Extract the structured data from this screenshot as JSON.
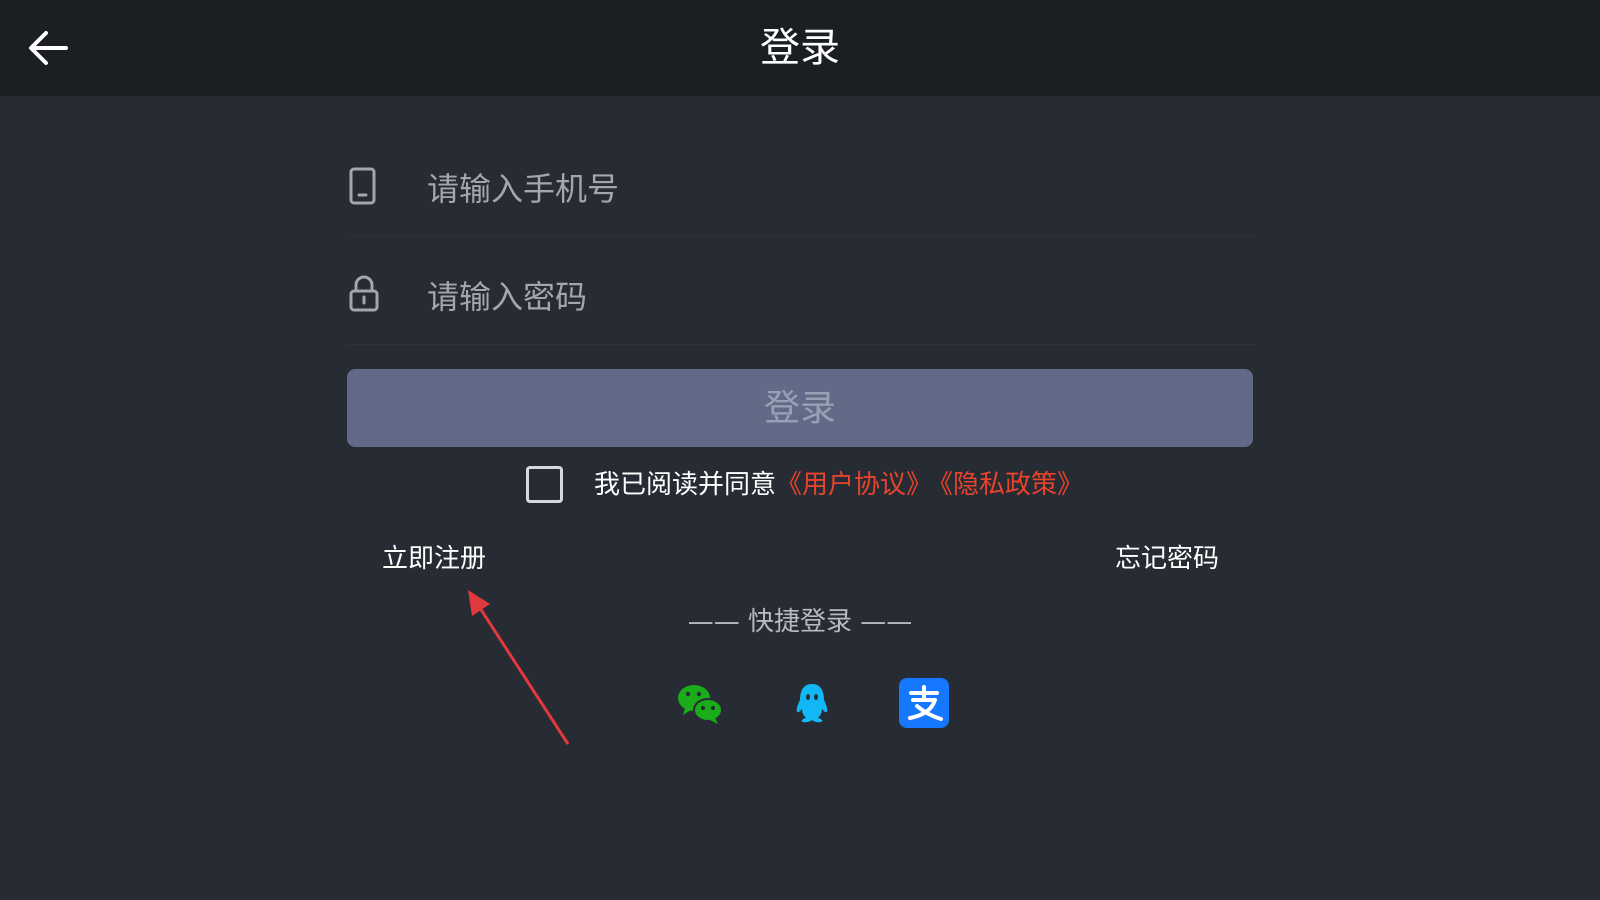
{
  "header": {
    "title": "登录",
    "back_icon": "arrow-left-icon"
  },
  "form": {
    "phone": {
      "placeholder": "请输入手机号",
      "value": "",
      "icon": "phone-icon"
    },
    "password": {
      "placeholder": "请输入密码",
      "value": "",
      "icon": "lock-icon"
    },
    "login_label": "登录"
  },
  "agreement": {
    "checked": false,
    "text": "我已阅读并同意",
    "user_agreement": "《用户协议》",
    "privacy_policy": "《隐私政策》"
  },
  "links": {
    "register": "立即注册",
    "forgot": "忘记密码"
  },
  "quick_login": {
    "label": "—— 快捷登录 ——",
    "providers": [
      "wechat-icon",
      "qq-icon",
      "alipay-icon"
    ]
  },
  "colors": {
    "background": "#272b33",
    "header": "#1b1e22",
    "button": "#626a87",
    "link_red": "#e8432c",
    "wechat": "#1aad19",
    "qq": "#12b7f5",
    "alipay": "#1677ff",
    "annotation_arrow": "#e0393e"
  }
}
